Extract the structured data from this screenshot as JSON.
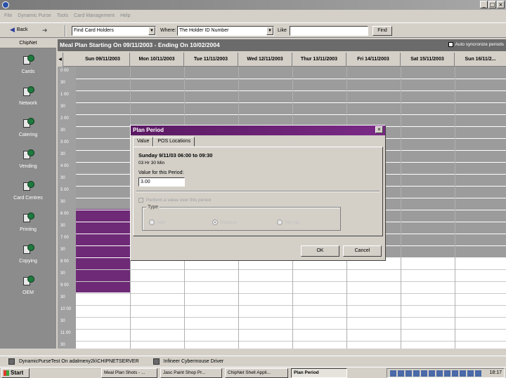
{
  "window": {
    "menu": [
      "File",
      "Dynamic Purse",
      "Tools",
      "Card Management",
      "Help"
    ],
    "controls": [
      "_",
      "□",
      "×"
    ]
  },
  "toolbar": {
    "back_label": "Back",
    "find_label": "Find",
    "find_value": "Card Holders",
    "where_label": "Where:",
    "where_value": "The Holder ID Number",
    "like_label": "Like",
    "like_value": "",
    "find_button": "Find"
  },
  "nav": {
    "header": "ChipNet",
    "items": [
      {
        "label": "Cards",
        "icon": "cards-icon"
      },
      {
        "label": "Network",
        "icon": "network-icon"
      },
      {
        "label": "Catering",
        "icon": "catering-icon"
      },
      {
        "label": "Vending",
        "icon": "vending-icon"
      },
      {
        "label": "Card Centres",
        "icon": "card-centres-icon"
      },
      {
        "label": "Printing",
        "icon": "printing-icon"
      },
      {
        "label": "Copying",
        "icon": "copying-icon"
      },
      {
        "label": "OEM",
        "icon": "oem-icon"
      }
    ]
  },
  "calendar": {
    "title": "Meal Plan Starting On 09/11/2003 - Ending On 10/02/2004",
    "autosync_label": "Auto syncronize periods",
    "days": [
      "Sun 09/11/2003",
      "Mon 10/11/2003",
      "Tue 11/11/2003",
      "Wed 12/11/2003",
      "Thur 13/11/2003",
      "Fri 14/11/2003",
      "Sat 15/11/2003",
      "Sun 16/11/2..."
    ],
    "times": [
      "0 00",
      "30",
      "1 00",
      "30",
      "2 00",
      "30",
      "3 00",
      "30",
      "4 00",
      "30",
      "5 00",
      "30",
      "6 00",
      "30",
      "7 00",
      "30",
      "8 00",
      "30",
      "9 00",
      "30",
      "10 00",
      "30",
      "11 00",
      "30"
    ]
  },
  "dialog": {
    "title": "Plan Period",
    "close": "×",
    "tabs": [
      "Value",
      "POS Locations"
    ],
    "period": "Sunday 9/11/03 06:00 to 09:30",
    "duration": "03 Hr 30 Min",
    "value_label": "Value for this Period:",
    "value": "3.00",
    "perform_label": "Perform a value over this period",
    "type_label": "Type",
    "types": [
      "Add",
      "Replace",
      "Top Up"
    ],
    "ok": "OK",
    "cancel": "Cancel"
  },
  "status": {
    "db": "DynamicPurseTest On adalmeny2k\\CHIPNETSERVER",
    "mouse": "Infineer Cybermouse Driver"
  },
  "taskbar": {
    "start": "Start",
    "tasks": [
      "Meal Plan Shots - ...",
      "Jasc Paint Shop Pr...",
      "ChipNet Shell Appli...",
      "Plan Period"
    ],
    "clock": "18:17"
  }
}
